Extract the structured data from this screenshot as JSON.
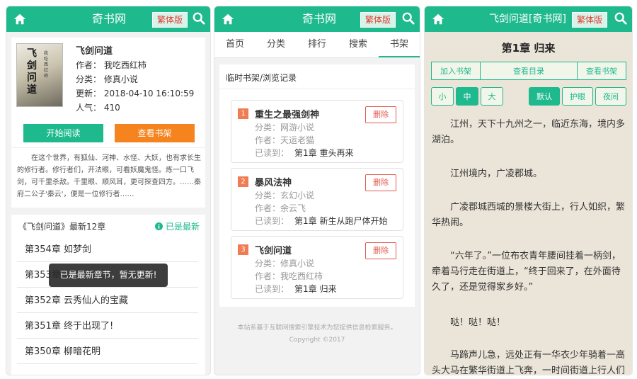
{
  "colors": {
    "accent": "#1fb98e",
    "orange": "#f5831e",
    "danger": "#e05a4e",
    "paper": "#ebe5d9"
  },
  "header": {
    "site_title": "奇书网",
    "reader_title": "飞剑问道[奇书网]",
    "trad_label": "繁体版"
  },
  "icons": {
    "home": "home-icon",
    "search": "search-icon",
    "info": "info-circle-icon"
  },
  "detail": {
    "cover_title": "飞剑问道",
    "cover_author": "我吃西红柿",
    "book_title": "飞剑问道",
    "author": "作者：  我吃西红柿",
    "category": "分类：  修真小说",
    "updated": "更新：  2018-04-10 16:10:59",
    "popularity": "人气：  410",
    "start_btn": "开始阅读",
    "shelf_btn": "查看书架",
    "description": "在这个世界，有狐仙、河神、水怪、大妖，也有求长生的修行者。修行者们，开法眼，可看妖魔鬼怪。炼一口飞剑，可千里杀敌。千里眼、顺风耳，更可探查四方。……秦府二公子'秦云'，便是一位修行者……",
    "latest_header": "《飞剑问道》最新12章",
    "latest_status": "已是最新",
    "chapters": [
      "第354章 如梦剑",
      "第353章 ……",
      "第352章 云秀仙人的宝藏",
      "第351章 终于出现了!",
      "第350章 柳暗花明"
    ],
    "toast": "已是最新章节，暂无更新!"
  },
  "nav": {
    "tabs": [
      "首页",
      "分类",
      "排行",
      "搜索",
      "书架"
    ],
    "active": "书架"
  },
  "shelf": {
    "heading": "临时书架/浏览记录",
    "delete_label": "删除",
    "cat_label": "分类：",
    "author_label": "作者：",
    "read_label": "已读到：",
    "items": [
      {
        "num": "1",
        "name": "重生之最强剑神",
        "category": "网游小说",
        "author": "天运老猫",
        "read_to": "第1章 重头再来"
      },
      {
        "num": "2",
        "name": "暴风法神",
        "category": "玄幻小说",
        "author": "余云飞",
        "read_to": "第1章 新生从跑尸体开始"
      },
      {
        "num": "3",
        "name": "飞剑问道",
        "category": "修真小说",
        "author": "我吃西红柿",
        "read_to": "第1章 归来"
      }
    ],
    "footer1": "本站系基于互联网搜索引擎技术为您提供信息检索服务。",
    "footer2": "Copyright ©2017"
  },
  "reader": {
    "chapter_title": "第1章 归来",
    "add_shelf": "加入书架",
    "toc": "查看目录",
    "view_shelf": "查看书架",
    "font_small": "小",
    "font_mid": "中",
    "font_large": "大",
    "theme_default": "默认",
    "theme_eye": "护眼",
    "theme_night": "夜间",
    "paragraphs": [
      "江州，天下十九州之一，临近东海，境内多湖泊。",
      "江州境内，广凌郡城。",
      "广凌郡城西城的景楼大街上，行人如织，繁华热闹。",
      "“六年了。”一位布衣青年腰间挂着一柄剑，牵着马行走在街道上，“终于回来了，在外面待久了，还是觉得家乡好。”",
      "哒！哒！哒！",
      "马蹄声儿急，远处正有一华衣少年骑着一高头大马在繁华街道上飞奔，一时间街道上行人们连"
    ]
  }
}
